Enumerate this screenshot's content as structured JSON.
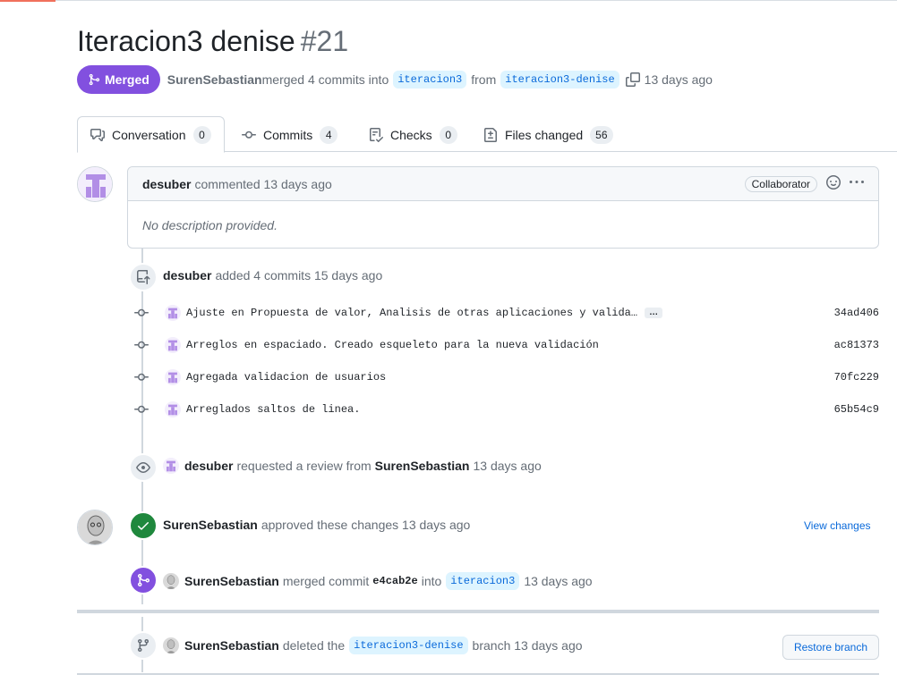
{
  "pr": {
    "title": "Iteracion3 denise",
    "number": "#21",
    "state": "Merged",
    "author": "SurenSebastian",
    "merged_text": "merged 4 commits into",
    "base_branch": "iteracion3",
    "from_text": "from",
    "head_branch": "iteracion3-denise",
    "time": "13 days ago"
  },
  "tabs": [
    {
      "label": "Conversation",
      "count": "0"
    },
    {
      "label": "Commits",
      "count": "4"
    },
    {
      "label": "Checks",
      "count": "0"
    },
    {
      "label": "Files changed",
      "count": "56"
    }
  ],
  "comment": {
    "author": "desuber",
    "action": "commented 13 days ago",
    "role": "Collaborator",
    "body": "No description provided."
  },
  "commits_event": {
    "author": "desuber",
    "text": "added 4 commits 15 days ago"
  },
  "commits": [
    {
      "message": "Ajuste en Propuesta de valor, Analisis de otras aplicaciones y valida…",
      "sha": "34ad406",
      "has_more": true,
      "more_label": "…"
    },
    {
      "message": "Arreglos en espaciado. Creado esqueleto para la nueva validación",
      "sha": "ac81373",
      "has_more": false
    },
    {
      "message": "Agregada validacion de usuarios",
      "sha": "70fc229",
      "has_more": false
    },
    {
      "message": "Arreglados saltos de linea.",
      "sha": "65b54c9",
      "has_more": false
    }
  ],
  "review_request": {
    "author": "desuber",
    "text": "requested a review from",
    "reviewer": "SurenSebastian",
    "time": "13 days ago"
  },
  "approval": {
    "author": "SurenSebastian",
    "text": "approved these changes 13 days ago",
    "link": "View changes"
  },
  "merge_event": {
    "author": "SurenSebastian",
    "text": "merged commit",
    "commit": "e4cab2e",
    "into": "into",
    "branch": "iteracion3",
    "time": "13 days ago"
  },
  "delete_event": {
    "author": "SurenSebastian",
    "text": "deleted the",
    "branch": "iteracion3-denise",
    "suffix": "branch 13 days ago",
    "button": "Restore branch"
  },
  "colors": {
    "merged": "#8250df",
    "approved": "#1f883d",
    "link": "#0969da",
    "accent": "#f0705c"
  }
}
